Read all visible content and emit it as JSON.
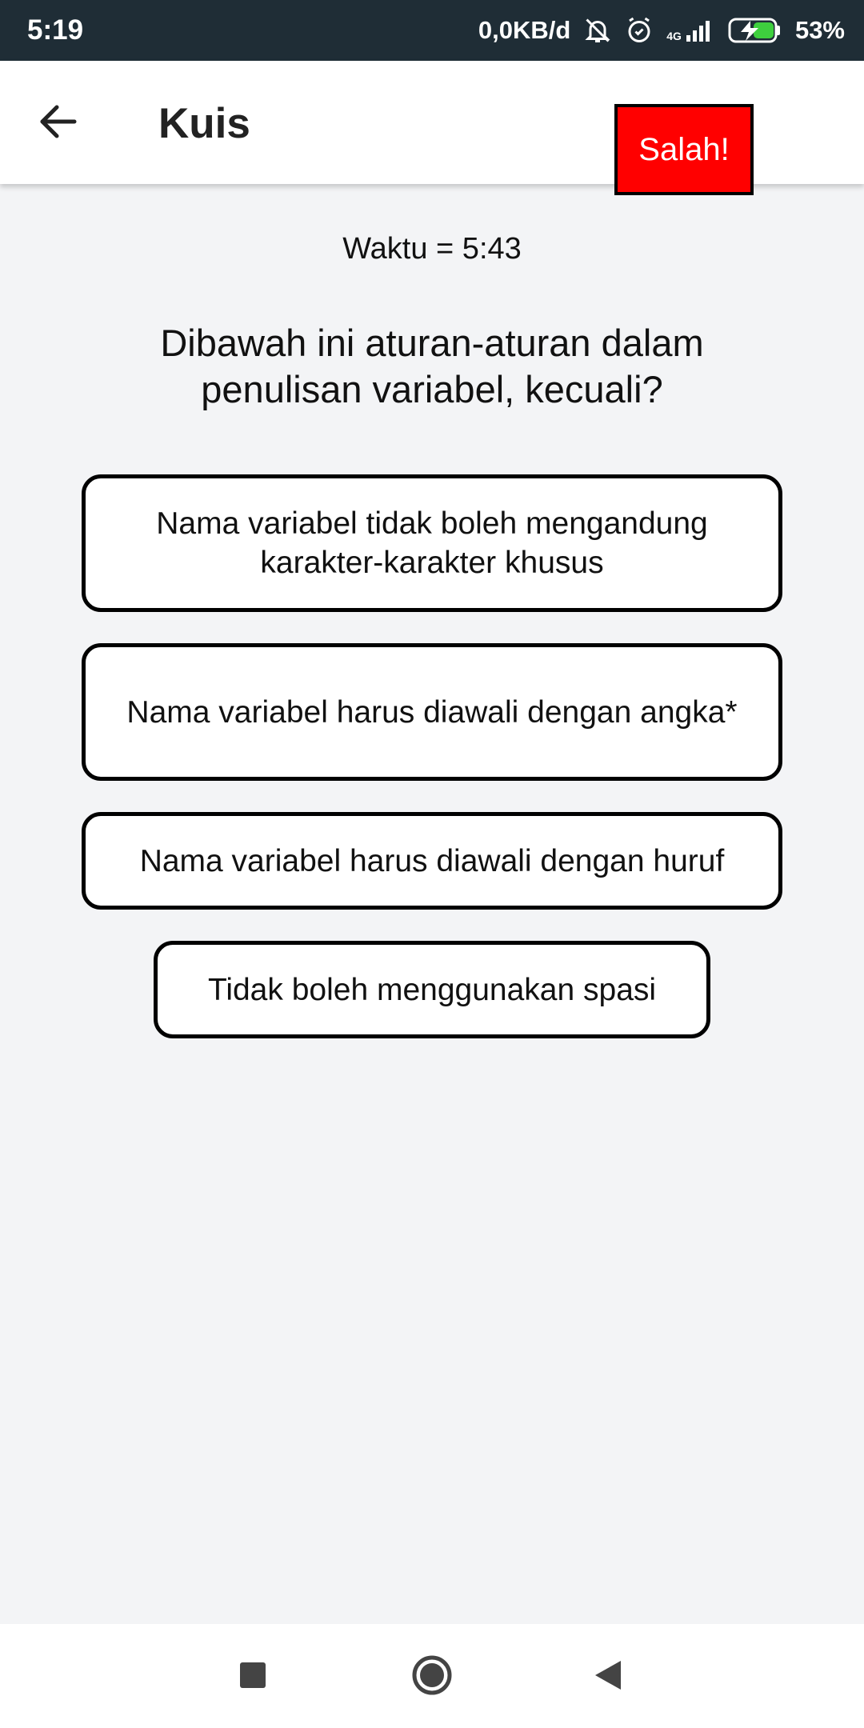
{
  "status_bar": {
    "time": "5:19",
    "network_speed": "0,0KB/d",
    "network_type": "4G",
    "battery": "53%",
    "icons": [
      "bell-off-icon",
      "alarm-icon",
      "signal-icon",
      "battery-charging-icon"
    ]
  },
  "app_bar": {
    "title": "Kuis",
    "back_icon": "arrow-left-icon"
  },
  "toast": {
    "text": "Salah!",
    "color": "#ff0000"
  },
  "quiz": {
    "timer": "Waktu = 5:43",
    "question": "Dibawah ini aturan-aturan dalam penulisan variabel, kecuali?",
    "options": [
      "Nama variabel tidak boleh mengandung karakter-karakter khusus",
      "Nama variabel harus diawali dengan angka*",
      "Nama variabel harus diawali dengan huruf",
      "Tidak boleh menggunakan spasi"
    ]
  },
  "nav_bar": {
    "icons": [
      "recents-square-icon",
      "home-circle-icon",
      "back-triangle-icon"
    ]
  }
}
